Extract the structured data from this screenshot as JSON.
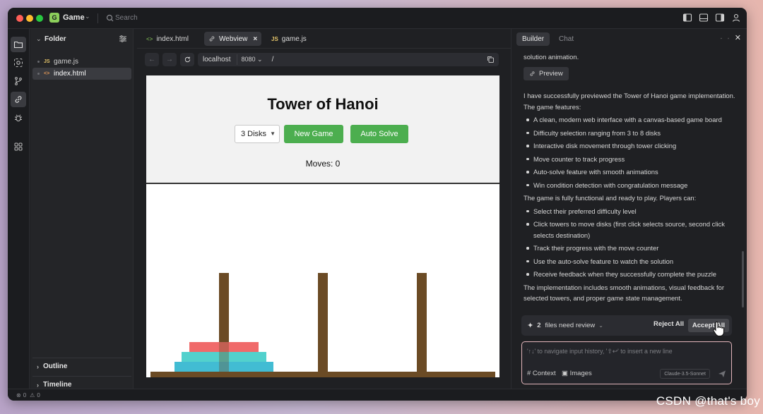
{
  "titlebar": {
    "project_badge": "G",
    "project_name": "Game",
    "search_placeholder": "Search"
  },
  "explorer": {
    "title": "Folder",
    "files": [
      {
        "name": "game.js",
        "type": "JS"
      },
      {
        "name": "index.html",
        "type": "<>"
      }
    ],
    "outline_label": "Outline",
    "timeline_label": "Timeline"
  },
  "editor": {
    "tabs": [
      {
        "label": "index.html",
        "icon": "<>"
      },
      {
        "label": "Webview",
        "icon": "link"
      },
      {
        "label": "game.js",
        "icon": "JS"
      }
    ],
    "url": {
      "host": "localhost",
      "port": "8080",
      "path": "/"
    }
  },
  "game": {
    "title": "Tower of Hanoi",
    "difficulty_selected": "3 Disks",
    "new_game_label": "New Game",
    "auto_solve_label": "Auto Solve",
    "moves_label": "Moves: 0",
    "colors": {
      "rod": "#6b4b25",
      "disk_small": "#f06a6a",
      "disk_medium": "#52d1cd",
      "disk_large": "#42bcd3",
      "button": "#4cae4f"
    }
  },
  "panel": {
    "tabs": [
      "Builder",
      "Chat"
    ],
    "pre_text": "solution animation.",
    "preview_label": "Preview",
    "intro": "I have successfully previewed the Tower of Hanoi game implementation. The game features:",
    "features": [
      "A clean, modern web interface with a canvas-based game board",
      "Difficulty selection ranging from 3 to 8 disks",
      "Interactive disk movement through tower clicking",
      "Move counter to track progress",
      "Auto-solve feature with smooth animations",
      "Win condition detection with congratulation message"
    ],
    "players_intro": "The game is fully functional and ready to play. Players can:",
    "player_items": [
      "Select their preferred difficulty level",
      "Click towers to move disks (first click selects source, second click selects destination)",
      "Track their progress with the move counter",
      "Use the auto-solve feature to watch the solution",
      "Receive feedback when they successfully complete the puzzle"
    ],
    "summary": "The implementation includes smooth animations, visual feedback for selected towers, and proper game state management.",
    "review": {
      "count": "2",
      "text": "files need review",
      "reject_label": "Reject All",
      "accept_label": "Accept All"
    },
    "input": {
      "placeholder": "'↑↓' to navigate input history, '⇧↩' to insert a new line",
      "context_label": "# Context",
      "images_label": "Images",
      "model": "Claude-3.5-Sonnet"
    }
  },
  "statusbar": {
    "errors": "0",
    "warnings": "0"
  },
  "watermark": "CSDN @that's boy"
}
